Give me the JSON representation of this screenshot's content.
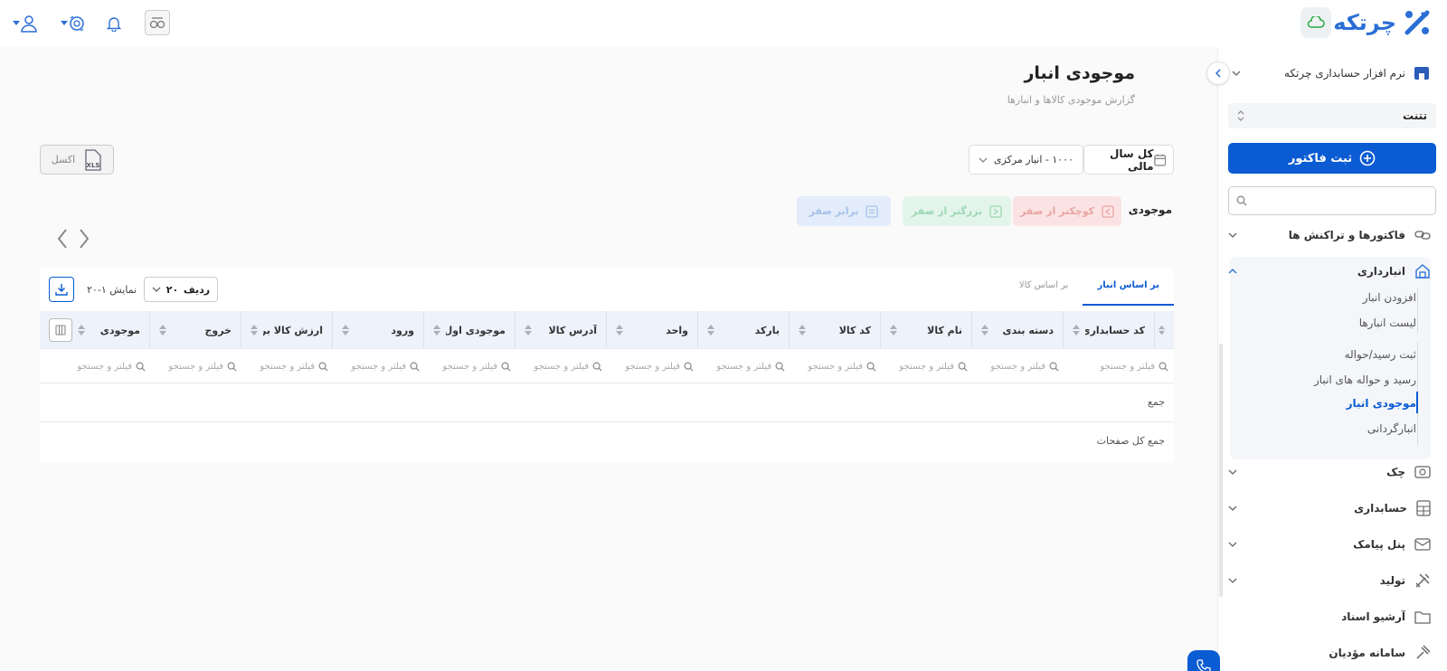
{
  "topbar": {
    "logo_text": "چرتکه",
    "icons": [
      "cloud-icon",
      "user-icon",
      "coin-icon",
      "bell-icon",
      "glasses-icon"
    ]
  },
  "sidebar": {
    "company_name": "نرم افزار حسابداری چرتکه",
    "tenant": "تتنت",
    "invoice_button": "ثبت فاکتور",
    "search_placeholder": "",
    "items": [
      {
        "label": "فاکتورها و تراکنش ها",
        "icon": "link-icon"
      },
      {
        "label": "انبارداری",
        "icon": "warehouse-icon"
      },
      {
        "label": "چک",
        "icon": "cheque-icon"
      },
      {
        "label": "حسابداری",
        "icon": "calculator-icon"
      },
      {
        "label": "پنل پیامک",
        "icon": "sms-icon"
      },
      {
        "label": "تولید",
        "icon": "tools-icon"
      },
      {
        "label": "آرشیو اسناد",
        "icon": "folder-icon"
      },
      {
        "label": "سامانه مؤدیان",
        "icon": "gavel-icon"
      }
    ],
    "warehouse_sub": [
      {
        "label": "افزودن انبار"
      },
      {
        "label": "لیست انبارها"
      },
      {
        "label": "ثبت رسید/حواله"
      },
      {
        "label": "رسید و حواله های انبار"
      },
      {
        "label": "موجودی انبار"
      },
      {
        "label": "انبارگردانی"
      }
    ]
  },
  "page": {
    "title": "موجودی انبار",
    "subtitle": "گزارش موجودی کالاها و انبارها",
    "year_filter": "کل سال مالی",
    "warehouse_filter": "۱۰۰۰ - انبار مرکزی",
    "excel_label": "اکسل",
    "excel_badge": "XLS",
    "stock_label": "موجودی",
    "filters": {
      "less": "کوچکتر از صفر",
      "greater": "بزرگتر از صفر",
      "equal": "برابر صفر"
    }
  },
  "table": {
    "tabs": [
      "بر اساس انبار",
      "بر اساس کالا"
    ],
    "rows_label": "ردیف",
    "rows_value": "۲۰",
    "showing": "نمایش ۱-۲۰",
    "columns": [
      "#",
      "کد حسابداری",
      "دسته بندی",
      "نام کالا",
      "کد کالا",
      "بارکد",
      "واحد",
      "آدرس کالا",
      "موجودی اول دوره",
      "ورود",
      "ارزش کالا براساس",
      "خروج",
      "موجودی"
    ],
    "filter_placeholder": "فیلتر و جستجو",
    "sum_label": "جمع",
    "sum_all_label": "جمع کل صفحات"
  },
  "colors": {
    "primary": "#0b5bd3",
    "brand": "#2a6fd6",
    "red_tint": "#fbe3e3",
    "green_tint": "#e3f5ea",
    "blue_tint": "#e3ecfa"
  }
}
